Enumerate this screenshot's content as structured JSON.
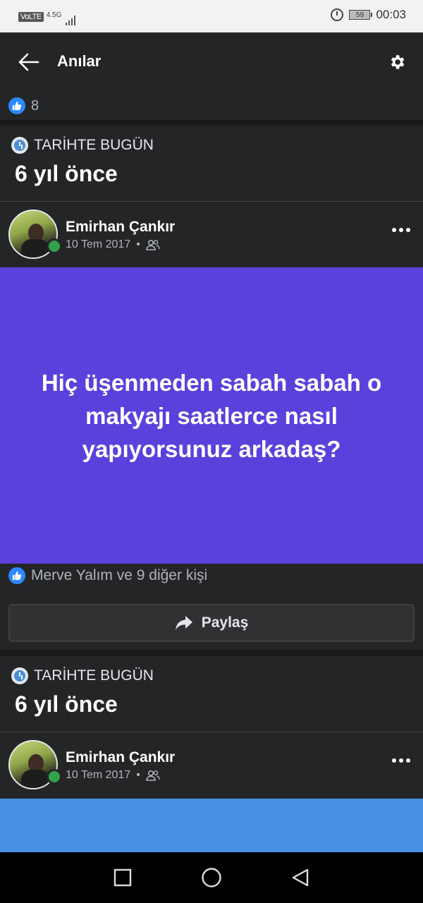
{
  "status_bar": {
    "volte": "VoLTE",
    "network": "4.5G",
    "battery": "59",
    "time": "00:03"
  },
  "header": {
    "title": "Anılar"
  },
  "likes_top": {
    "count": "8"
  },
  "memories": [
    {
      "history_label": "TARİHTE BUGÜN",
      "years_ago": "6 yıl önce",
      "author": "Emirhan Çankır",
      "date": "10 Tem 2017",
      "post_text": "Hiç üşenmeden sabah sabah o makyajı saatlerce nasıl yapıyorsunuz arkadaş?",
      "post_bg_color": "#5c40dc",
      "reactions": "Merve Yalım ve 9 diğer kişi",
      "share_label": "Paylaş"
    },
    {
      "history_label": "TARİHTE BUGÜN",
      "years_ago": "6 yıl önce",
      "author": "Emirhan Çankır",
      "date": "10 Tem 2017",
      "post_bg_color": "#4a90e2"
    }
  ],
  "icons": {
    "back": "arrow-left-icon",
    "settings": "gear-icon",
    "like": "thumbs-up-icon",
    "history": "clock-icon",
    "audience": "friends-icon",
    "more": "more-horizontal-icon",
    "share": "share-arrow-icon"
  }
}
